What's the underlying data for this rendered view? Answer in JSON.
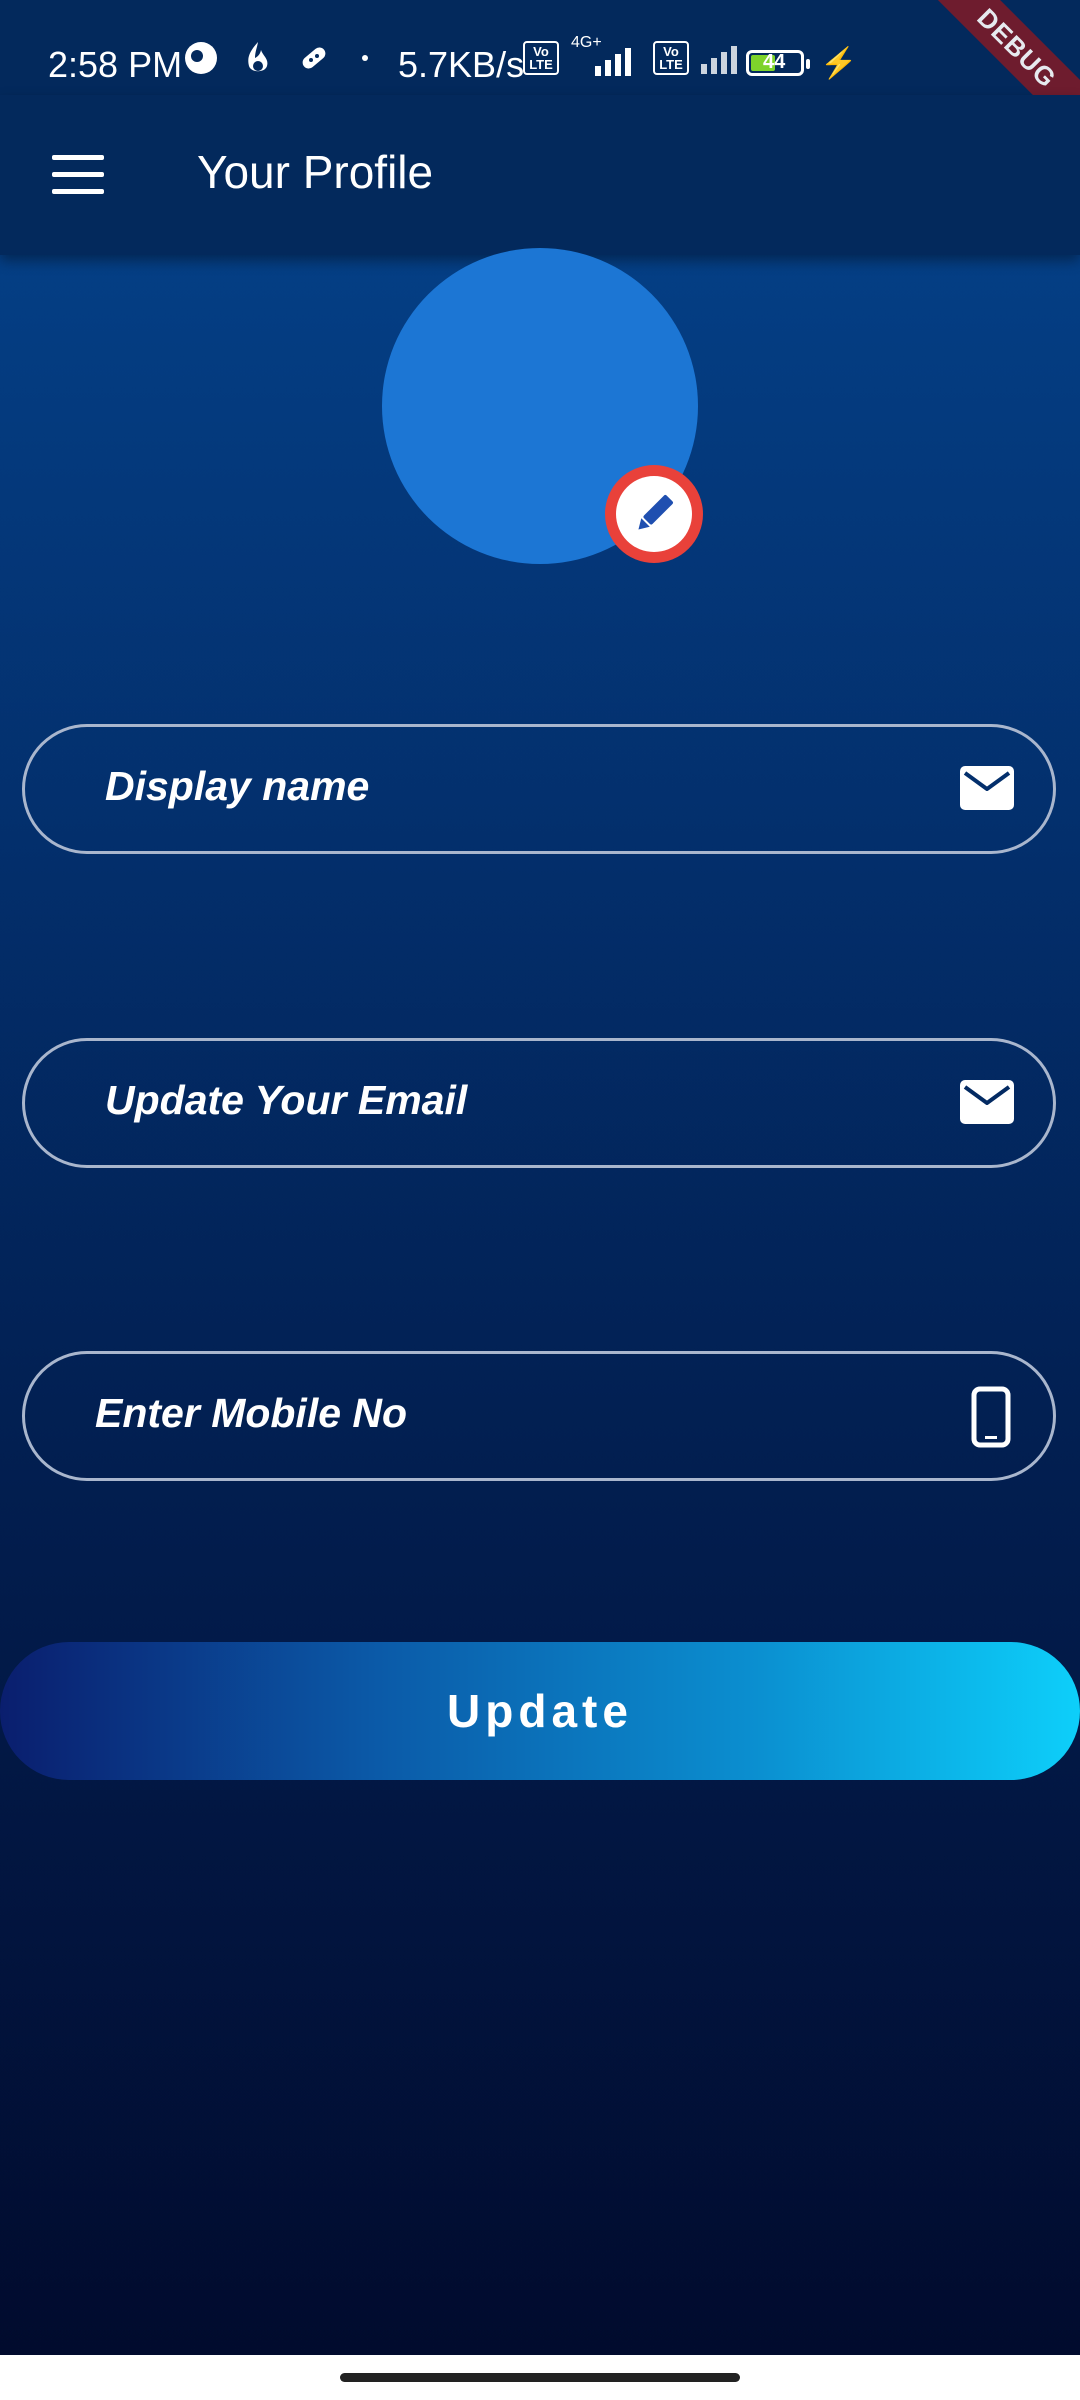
{
  "status_bar": {
    "time": "2:58 PM",
    "speed": "5.7KB/s",
    "volte1": "Vo LTE",
    "net_type": "4G+",
    "volte2": "Vo LTE",
    "battery": "44",
    "icons": [
      "ring-icon",
      "flame-icon",
      "pill-icon",
      "dot-icon",
      "charging-bolt-icon"
    ]
  },
  "debug_banner": "DEBUG",
  "app_bar": {
    "title": "Your Profile",
    "menu_icon": "hamburger-menu-icon"
  },
  "profile": {
    "edit_icon": "pencil-icon",
    "avatar_color": "#1c76d4",
    "edit_color": "#e9413a"
  },
  "form": {
    "display_name_placeholder": "Display name",
    "email_placeholder": "Update Your Email",
    "mobile_placeholder": "Enter Mobile No",
    "display_name_icon": "mail-icon",
    "email_icon": "mail-icon",
    "mobile_icon": "phone-icon"
  },
  "update_button": {
    "label": "Update",
    "gradient": [
      "#0a1e6e",
      "#0dcffa"
    ]
  }
}
